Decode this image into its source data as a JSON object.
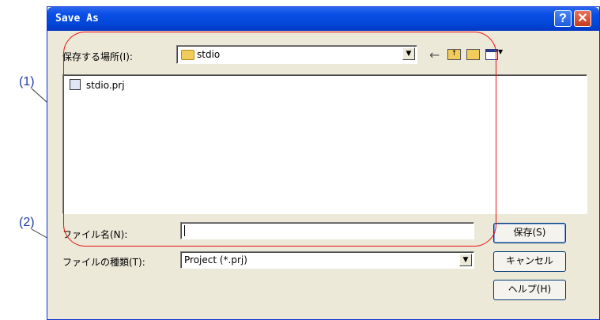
{
  "dialog": {
    "title": "Save As",
    "help_button": "?",
    "close_button": "✕"
  },
  "location": {
    "label": "保存する場所(I):",
    "folder": "stdio",
    "toolbar_icons": [
      "back-arrow-icon",
      "up-folder-icon",
      "new-folder-icon",
      "view-menu-icon"
    ]
  },
  "file_list": [
    {
      "name": "stdio.prj",
      "icon": "project-file-icon"
    }
  ],
  "filename": {
    "label": "ファイル名(N):",
    "value": ""
  },
  "filetype": {
    "label": "ファイルの種類(T):",
    "value": "Project (*.prj)"
  },
  "buttons": {
    "save": "保存(S)",
    "cancel": "キャンセル",
    "help": "ヘルプ(H)"
  },
  "annotations": {
    "callout_1": "(1)",
    "callout_2": "(2)",
    "ring_color": "#e81010",
    "callout_color": "#1e3aa8"
  }
}
